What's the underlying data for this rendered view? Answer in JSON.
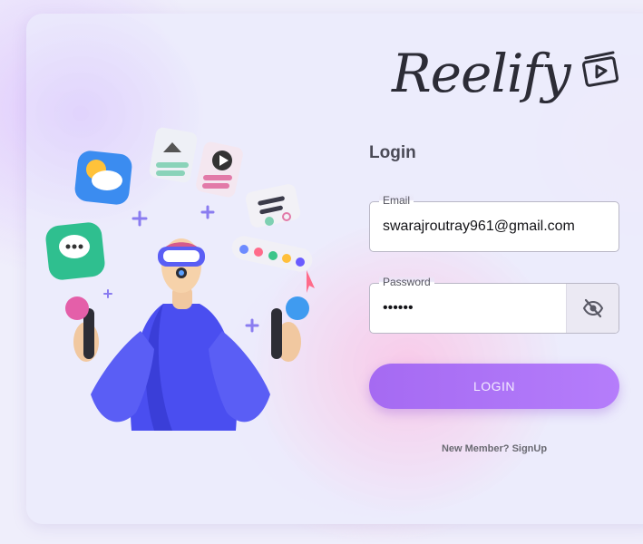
{
  "brand": {
    "name": "Reelify",
    "icon": "video-play-icon"
  },
  "login": {
    "title": "Login",
    "email_label": "Email",
    "email_value": "swarajroutray961@gmail.com",
    "password_label": "Password",
    "password_value": "••••••",
    "toggle_icon": "eye-off-icon",
    "submit_label": "LOGIN",
    "signup_text": "New Member? SignUp"
  },
  "colors": {
    "accent": "#a56af2",
    "text_dark": "#2c2c36",
    "background": "#efeefb"
  }
}
